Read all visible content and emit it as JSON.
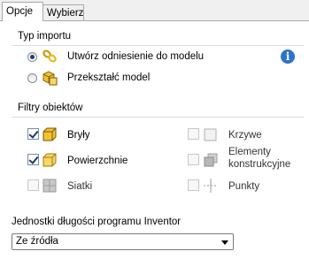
{
  "tabs": [
    {
      "label": "Opcje",
      "active": true
    },
    {
      "label": "Wybierz",
      "active": false
    }
  ],
  "import_type": {
    "title": "Typ importu",
    "options": [
      {
        "label": "Utwórz odniesienie do modelu",
        "selected": true,
        "icon": "link-chain-icon"
      },
      {
        "label": "Przekształć model",
        "selected": false,
        "icon": "convert-model-icon"
      }
    ],
    "info_icon": "info-icon",
    "info_glyph": "i"
  },
  "object_filters": {
    "title": "Filtry obiektów",
    "left": [
      {
        "label": "Bryły",
        "checked": true,
        "enabled": true,
        "icon": "solid-cube-icon"
      },
      {
        "label": "Powierzchnie",
        "checked": true,
        "enabled": true,
        "icon": "surface-icon"
      },
      {
        "label": "Siatki",
        "checked": false,
        "enabled": false,
        "icon": "mesh-icon"
      }
    ],
    "right": [
      {
        "label": "Krzywe",
        "checked": false,
        "enabled": false,
        "icon": "curve-icon"
      },
      {
        "label_line1": "Elementy",
        "label_line2": "konstrukcyjne",
        "checked": false,
        "enabled": false,
        "icon": "construction-elements-icon"
      },
      {
        "label": "Punkty",
        "checked": false,
        "enabled": false,
        "icon": "point-icon"
      }
    ]
  },
  "units": {
    "title": "Jednostki długości programu Inventor",
    "value": "Ze źródła"
  },
  "colors": {
    "accent": "#2b74c9",
    "icon_yellow": "#f2c230",
    "group_line": "#d5dfe5"
  }
}
